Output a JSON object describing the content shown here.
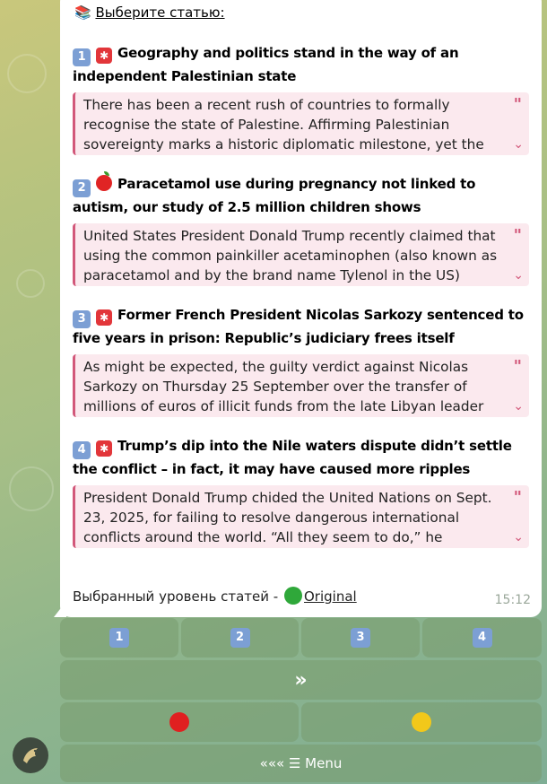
{
  "message": {
    "header_icon": "books-icon",
    "header_emoji": "📚",
    "header_text": "Выберите статью:",
    "articles": [
      {
        "number": "1",
        "topic_icon": "red-badge-icon",
        "title": "Geography and politics stand in the way of an independent Palestinian state",
        "excerpt": "There has been a recent rush of countries to formally recognise the state of Palestine. Affirming Palestinian sovereignty marks a historic diplomatic milestone, yet the"
      },
      {
        "number": "2",
        "topic_icon": "apple-icon",
        "title": "Paracetamol use during pregnancy not linked to autism, our study of 2.5 million children shows",
        "excerpt": "United States President Donald Trump recently claimed that using the common painkiller acetaminophen (also known as paracetamol and by the brand name Tylenol in the US) during"
      },
      {
        "number": "3",
        "topic_icon": "red-badge-icon",
        "title": "Former French President Nicolas Sarkozy sentenced to five years in prison: Republic’s judiciary frees itself",
        "excerpt": "As might be expected, the guilty verdict against Nicolas Sarkozy on Thursday 25 September over the transfer of millions of euros of illicit funds from the late Libyan leader Col"
      },
      {
        "number": "4",
        "topic_icon": "red-badge-icon",
        "title": "Trump’s dip into the Nile waters dispute didn’t settle the conflict – in fact, it may have caused more ripples",
        "excerpt": "President Donald Trump chided the United Nations on Sept. 23, 2025, for failing to resolve dangerous international conflicts around the world. “All they seem to do,” he groused"
      }
    ],
    "level_label": "Выбранный уровень статей -",
    "level_value": "Original",
    "level_color": "#2fa83a",
    "time": "15:12"
  },
  "keyboard": {
    "number_buttons": [
      "1",
      "2",
      "3",
      "4"
    ],
    "next_label": "»",
    "level_buttons": [
      {
        "icon": "red-circle-icon",
        "color": "#e02020"
      },
      {
        "icon": "yellow-circle-icon",
        "color": "#f2c81a"
      }
    ],
    "menu_label": "««« ☰ Menu"
  },
  "colors": {
    "quote_accent": "#d2587a",
    "quote_bg": "#fbe9ee",
    "number_badge": "#7c9fd4"
  }
}
